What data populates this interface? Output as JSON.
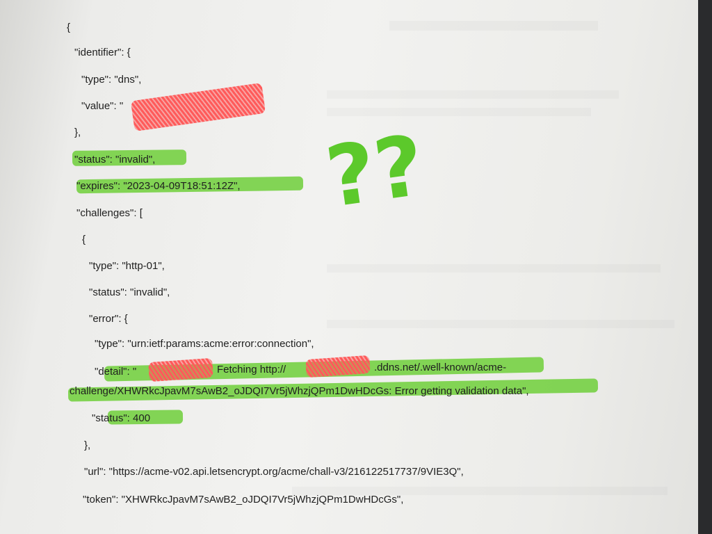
{
  "document": {
    "lines": [
      "{",
      "\"identifier\": {",
      "\"type\": \"dns\",",
      "\"value\": \"",
      "},",
      "\"status\": \"invalid\",",
      "\"expires\": \"2023-04-09T18:51:12Z\",",
      "\"challenges\": [",
      "{",
      "\"type\": \"http-01\",",
      "\"status\": \"invalid\",",
      "\"error\": {",
      "\"type\": \"urn:ietf:params:acme:error:connection\",",
      "\"detail\": \"",
      "challenge/XHWRkcJpavM7sAwB2_oJDQI7Vr5jWhzjQPm1DwHDcGs: Error getting validation data\",",
      "\"status\": 400",
      "},",
      "\"url\": \"https://acme-v02.api.letsencrypt.org/acme/chall-v3/216122517737/9VIE3Q\",",
      "\"token\": \"XHWRkcJpavM7sAwB2_oJDQI7Vr5jWhzjQPm1DwHDcGs\","
    ],
    "detail_fetch": "Fetching http://",
    "detail_domain": ".ddns.net/.well-known/acme-",
    "annotation": "??"
  },
  "colors": {
    "highlight": "#6fcf3a",
    "redaction": "#ff5a5a",
    "ink": "#1f1f1f"
  }
}
